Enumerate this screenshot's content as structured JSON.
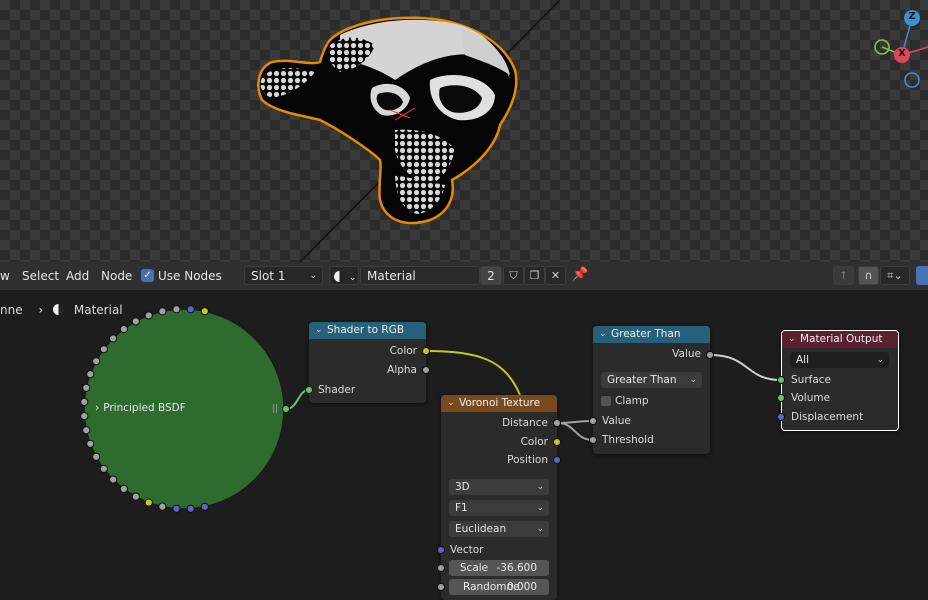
{
  "colors": {
    "shader_header": "#27607a",
    "texture_header": "#7a4a1f",
    "converter_header": "#27607a",
    "output_header": "#5a2130",
    "socket_color": "#c7c729",
    "socket_float": "#a1a1a1",
    "socket_vector": "#6363c7",
    "socket_shader": "#63c763",
    "principled_fill": "#2e6b2e",
    "selection_outline": "#e68a00"
  },
  "menu": {
    "view_partial": "w",
    "select": "Select",
    "add": "Add",
    "node": "Node",
    "use_nodes": "Use Nodes",
    "use_nodes_checked": true
  },
  "material_bar": {
    "slot": "Slot 1",
    "material_name": "Material",
    "users": "2"
  },
  "breadcrumb": {
    "object_partial": "nne",
    "material": "Material"
  },
  "gizmo": {
    "z": "Z",
    "x": "X"
  },
  "nodes": {
    "principled": {
      "label": "Principled BSDF"
    },
    "shader_to_rgb": {
      "title": "Shader to RGB",
      "outputs": [
        "Color",
        "Alpha"
      ],
      "inputs": [
        "Shader"
      ]
    },
    "voronoi": {
      "title": "Voronoi Texture",
      "outputs": [
        "Distance",
        "Color",
        "Position"
      ],
      "dimension": "3D",
      "feature": "F1",
      "metric": "Euclidean",
      "vector_label": "Vector",
      "scale_label": "Scale",
      "scale_value": "-36.600",
      "randomness_label": "Randomne",
      "randomness_value": "0.000"
    },
    "greater_than": {
      "title": "Greater Than",
      "output": "Value",
      "operation": "Greater Than",
      "clamp": "Clamp",
      "inputs": [
        "Value",
        "Threshold"
      ]
    },
    "material_output": {
      "title": "Material Output",
      "target": "All",
      "inputs": [
        "Surface",
        "Volume",
        "Displacement"
      ]
    }
  }
}
